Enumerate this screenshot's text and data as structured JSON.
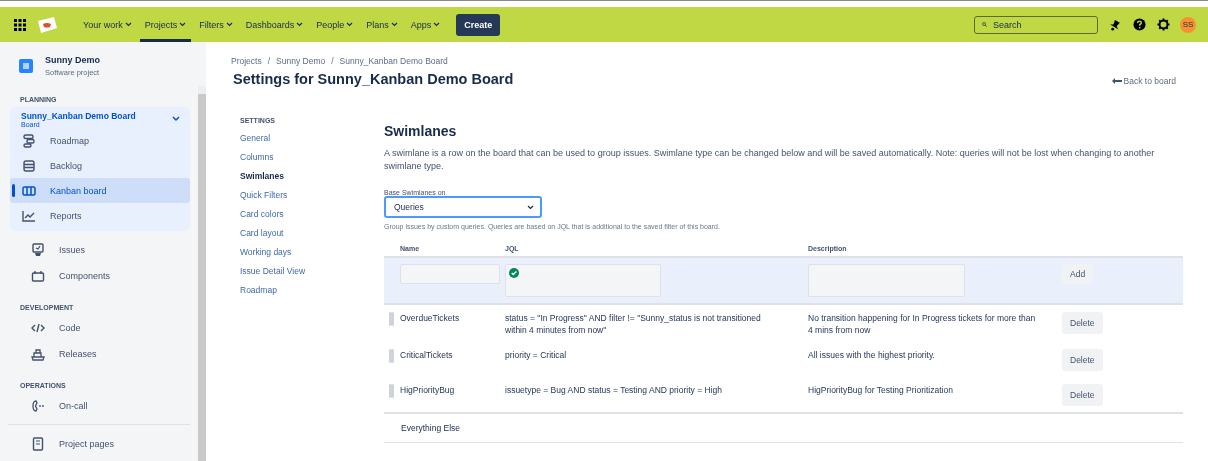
{
  "nav": {
    "items": [
      {
        "label": "Your work",
        "selected": false
      },
      {
        "label": "Projects",
        "selected": true
      },
      {
        "label": "Filters",
        "selected": false
      },
      {
        "label": "Dashboards",
        "selected": false
      },
      {
        "label": "People",
        "selected": false
      },
      {
        "label": "Plans",
        "selected": false
      },
      {
        "label": "Apps",
        "selected": false
      }
    ],
    "create": "Create",
    "search": {
      "placeholder": "Search"
    },
    "avatar": "SS"
  },
  "sidebar": {
    "project": {
      "name": "Sunny Demo",
      "type": "Software project"
    },
    "sections": [
      {
        "heading": "PLANNING",
        "board": {
          "title": "Sunny_Kanban Demo Board",
          "subtitle": "Board",
          "expanded": true,
          "items": [
            {
              "label": "Roadmap",
              "selected": false
            },
            {
              "label": "Backlog",
              "selected": false
            },
            {
              "label": "Kanban board",
              "selected": true
            },
            {
              "label": "Reports",
              "selected": false
            }
          ]
        },
        "items": [
          {
            "label": "Issues",
            "selected": false
          },
          {
            "label": "Components",
            "selected": false
          }
        ]
      },
      {
        "heading": "DEVELOPMENT",
        "items": [
          {
            "label": "Code",
            "selected": false
          },
          {
            "label": "Releases",
            "selected": false
          }
        ]
      },
      {
        "heading": "OPERATIONS",
        "items": [
          {
            "label": "On-call",
            "selected": false
          }
        ]
      }
    ],
    "footer_items": [
      {
        "label": "Project pages",
        "selected": false
      }
    ]
  },
  "breadcrumbs": {
    "separator": "/",
    "items": [
      "Projects",
      "Sunny Demo",
      "Sunny_Kanban Demo Board"
    ]
  },
  "title": "Settings for Sunny_Kanban Demo Board",
  "back_link": "Back to board",
  "settings_nav": {
    "heading": "SETTINGS",
    "items": [
      {
        "label": "General",
        "selected": false
      },
      {
        "label": "Columns",
        "selected": false
      },
      {
        "label": "Swimlanes",
        "selected": true
      },
      {
        "label": "Quick Filters",
        "selected": false
      },
      {
        "label": "Card colors",
        "selected": false
      },
      {
        "label": "Card layout",
        "selected": false
      },
      {
        "label": "Working days",
        "selected": false
      },
      {
        "label": "Issue Detail View",
        "selected": false
      },
      {
        "label": "Roadmap",
        "selected": false
      }
    ]
  },
  "swimlanes": {
    "heading": "Swimlanes",
    "description": "A swimlane is a row on the board that can be used to group issues. Swimlane type can be changed below and will be saved automatically. Note: queries will not be lost when changing to another swimlane type.",
    "base_label": "Base Swimlanes on",
    "base_value": "Queries",
    "hint": "Group issues by custom queries. Queries are based on JQL that is additional to the saved filter of this board.",
    "columns": [
      "Name",
      "JQL",
      "Description"
    ],
    "add_row": {
      "jql_valid": true,
      "button": "Add"
    },
    "rows": [
      {
        "name": "OverdueTickets",
        "jql": "status = \"In Progress\" AND filter != \"Sunny_status is not transitioned within 4 minutes from now\"",
        "description": "No transition happening for In Progress tickets for more than 4 mins from now",
        "button": "Delete"
      },
      {
        "name": "CriticalTickets",
        "jql": "priority = Critical",
        "description": "All issues with the highest priority.",
        "button": "Delete"
      },
      {
        "name": "HigPriorityBug",
        "jql": "issuetype = Bug AND status = Testing AND priority = High",
        "description": "HigPriorityBug for Testing Prioritization",
        "button": "Delete"
      }
    ],
    "default_row": "Everything Else"
  }
}
